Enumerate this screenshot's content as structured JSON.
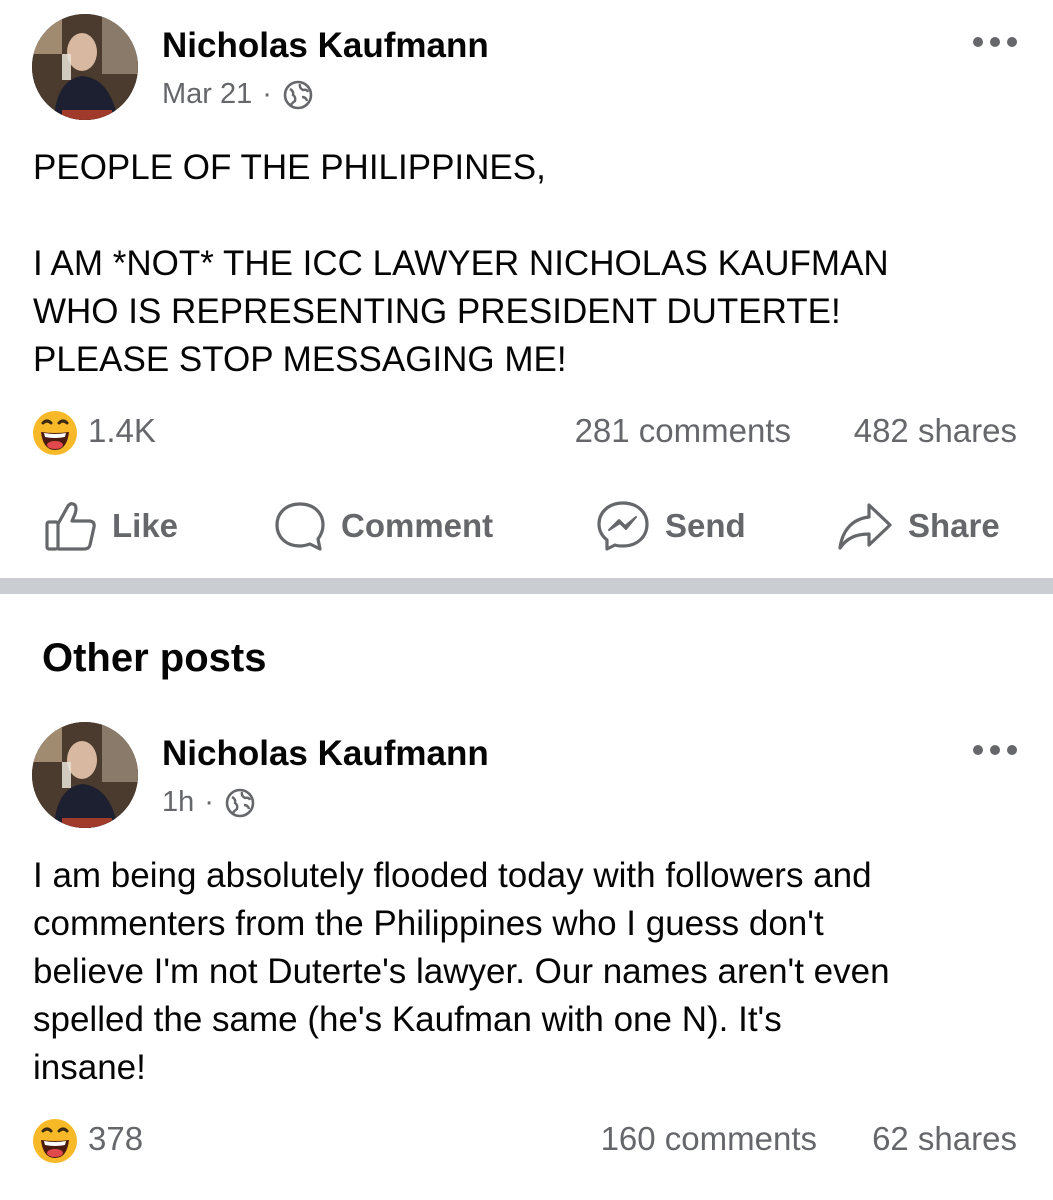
{
  "post1": {
    "author": "Nicholas Kaufmann",
    "date": "Mar 21",
    "separator": "·",
    "privacy_icon": "globe-icon",
    "text": "PEOPLE OF THE PHILIPPINES,\n\nI AM *NOT* THE ICC LAWYER NICHOLAS KAUFMAN\nWHO IS REPRESENTING PRESIDENT DUTERTE!\nPLEASE STOP MESSAGING ME!",
    "reaction_icon": "haha-emoji-icon",
    "reaction_count": "1.4K",
    "comments": "281 comments",
    "shares": "482 shares"
  },
  "actions": {
    "like": "Like",
    "comment": "Comment",
    "send": "Send",
    "share": "Share"
  },
  "other_posts": {
    "title": "Other posts"
  },
  "post2": {
    "author": "Nicholas Kaufmann",
    "date": "1h",
    "separator": "·",
    "privacy_icon": "globe-icon",
    "text": "I am being absolutely flooded today with followers and\ncommenters from the Philippines who I guess don't\nbelieve I'm not Duterte's lawyer. Our names aren't even\nspelled the same (he's Kaufman with one N). It's\ninsane!",
    "reaction_icon": "haha-emoji-icon",
    "reaction_count": "378",
    "comments": "160 comments",
    "shares": "62 shares"
  },
  "colors": {
    "text": "#050505",
    "secondary": "#65676b",
    "divider": "#cacdd2",
    "emoji_face": "#f7b928"
  }
}
